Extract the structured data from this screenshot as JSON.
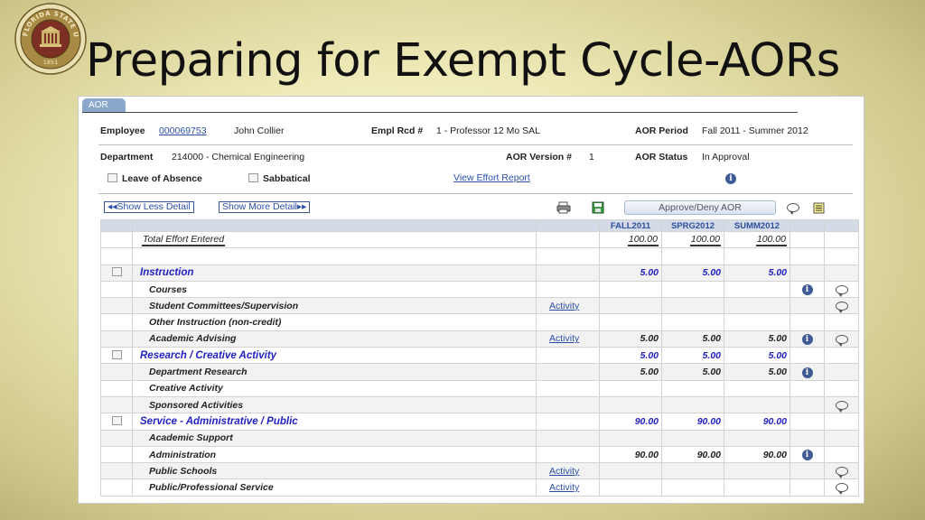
{
  "slide": {
    "title": "Preparing for Exempt Cycle-AORs",
    "seal_text": "FLORIDA STATE UNIVERSITY",
    "seal_year": "1851"
  },
  "tab": {
    "label": "AOR"
  },
  "employee": {
    "label": "Employee",
    "id": "000069753",
    "name": "John Collier",
    "empl_rcd_label": "Empl Rcd #",
    "empl_rcd_value": "1 - Professor  12 Mo SAL",
    "aor_period_label": "AOR Period",
    "aor_period_value": "Fall 2011 - Summer 2012",
    "department_label": "Department",
    "department_value": "214000 - Chemical Engineering",
    "aor_version_label": "AOR Version #",
    "aor_version_value": "1",
    "aor_status_label": "AOR Status",
    "aor_status_value": "In Approval",
    "leave_label": "Leave of Absence",
    "sabbatical_label": "Sabbatical",
    "view_effort_report": "View Effort Report"
  },
  "toolbar": {
    "show_less": "Show Less Detail",
    "show_more": "Show More Detail",
    "approve_deny": "Approve/Deny AOR"
  },
  "grid": {
    "columns": [
      "FALL2011",
      "SPRG2012",
      "SUMM2012"
    ],
    "total": {
      "label": "Total Effort Entered",
      "values": [
        "100.00",
        "100.00",
        "100.00"
      ]
    },
    "rows": [
      {
        "label": "Instruction",
        "type": "section",
        "checkbox": true,
        "activity": "",
        "values": [
          "5.00",
          "5.00",
          "5.00"
        ],
        "info": false,
        "comment": false
      },
      {
        "label": "Courses",
        "type": "sub",
        "checkbox": false,
        "activity": "",
        "values": [
          "",
          "",
          ""
        ],
        "info": true,
        "comment": true
      },
      {
        "label": "Student Committees/Supervision",
        "type": "sub",
        "checkbox": false,
        "activity": "Activity",
        "values": [
          "",
          "",
          ""
        ],
        "info": false,
        "comment": true
      },
      {
        "label": "Other Instruction (non-credit)",
        "type": "sub",
        "checkbox": false,
        "activity": "",
        "values": [
          "",
          "",
          ""
        ],
        "info": false,
        "comment": false
      },
      {
        "label": "Academic Advising",
        "type": "sub",
        "checkbox": false,
        "activity": "Activity",
        "values": [
          "5.00",
          "5.00",
          "5.00"
        ],
        "info": true,
        "comment": true
      },
      {
        "label": "Research / Creative Activity",
        "type": "section",
        "checkbox": true,
        "activity": "",
        "values": [
          "5.00",
          "5.00",
          "5.00"
        ],
        "info": false,
        "comment": false
      },
      {
        "label": "Department Research",
        "type": "sub",
        "checkbox": false,
        "activity": "",
        "values": [
          "5.00",
          "5.00",
          "5.00"
        ],
        "info": true,
        "comment": false
      },
      {
        "label": "Creative Activity",
        "type": "sub",
        "checkbox": false,
        "activity": "",
        "values": [
          "",
          "",
          ""
        ],
        "info": false,
        "comment": false
      },
      {
        "label": "Sponsored Activities",
        "type": "sub",
        "checkbox": false,
        "activity": "",
        "values": [
          "",
          "",
          ""
        ],
        "info": false,
        "comment": true
      },
      {
        "label": "Service - Administrative / Public",
        "type": "section",
        "checkbox": true,
        "activity": "",
        "values": [
          "90.00",
          "90.00",
          "90.00"
        ],
        "info": false,
        "comment": false
      },
      {
        "label": "Academic Support",
        "type": "sub",
        "checkbox": false,
        "activity": "",
        "values": [
          "",
          "",
          ""
        ],
        "info": false,
        "comment": false
      },
      {
        "label": "Administration",
        "type": "sub",
        "checkbox": false,
        "activity": "",
        "values": [
          "90.00",
          "90.00",
          "90.00"
        ],
        "info": true,
        "comment": false
      },
      {
        "label": "Public Schools",
        "type": "sub",
        "checkbox": false,
        "activity": "Activity",
        "values": [
          "",
          "",
          ""
        ],
        "info": false,
        "comment": true
      },
      {
        "label": "Public/Professional Service",
        "type": "sub",
        "checkbox": false,
        "activity": "Activity",
        "values": [
          "",
          "",
          ""
        ],
        "info": false,
        "comment": true
      }
    ]
  }
}
